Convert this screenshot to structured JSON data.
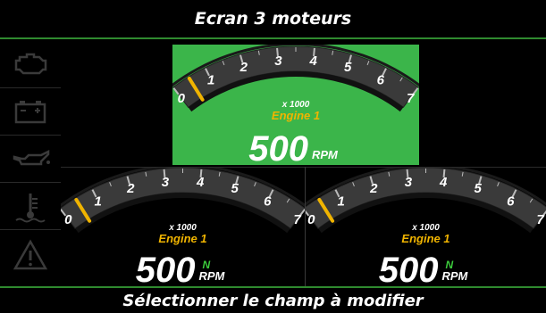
{
  "header": {
    "title": "Ecran 3 moteurs"
  },
  "footer": {
    "instruction": "Sélectionner le champ à modifier"
  },
  "sidebar": {
    "icons": [
      "check-engine-icon",
      "battery-icon",
      "oil-pressure-icon",
      "coolant-temperature-icon",
      "warning-triangle-icon"
    ]
  },
  "colors": {
    "accent_green": "#2f8a2f",
    "selected_panel": "#3bb54a",
    "gauge_arc": "#3a3a3a",
    "engine_label": "#f0b400",
    "neutral_indicator": "#3ccc3c",
    "needle": "#f0b400",
    "icon_dim": "#3a3a3a"
  },
  "gauges": [
    {
      "id": "top",
      "selected": true,
      "engine_label": "Engine 1",
      "multiplier": "x 1000",
      "rpm_value": "500",
      "rpm_unit": "RPM",
      "gear": "",
      "ticks": [
        "0",
        "1",
        "2",
        "3",
        "4",
        "5",
        "6",
        "7"
      ],
      "rpm_fraction": 0.07
    },
    {
      "id": "bottom-left",
      "selected": false,
      "engine_label": "Engine 1",
      "multiplier": "x 1000",
      "rpm_value": "500",
      "rpm_unit": "RPM",
      "gear": "N",
      "ticks": [
        "0",
        "1",
        "2",
        "3",
        "4",
        "5",
        "6",
        "7"
      ],
      "rpm_fraction": 0.07
    },
    {
      "id": "bottom-right",
      "selected": false,
      "engine_label": "Engine 1",
      "multiplier": "x 1000",
      "rpm_value": "500",
      "rpm_unit": "RPM",
      "gear": "N",
      "ticks": [
        "0",
        "1",
        "2",
        "3",
        "4",
        "5",
        "6",
        "7"
      ],
      "rpm_fraction": 0.07
    }
  ]
}
